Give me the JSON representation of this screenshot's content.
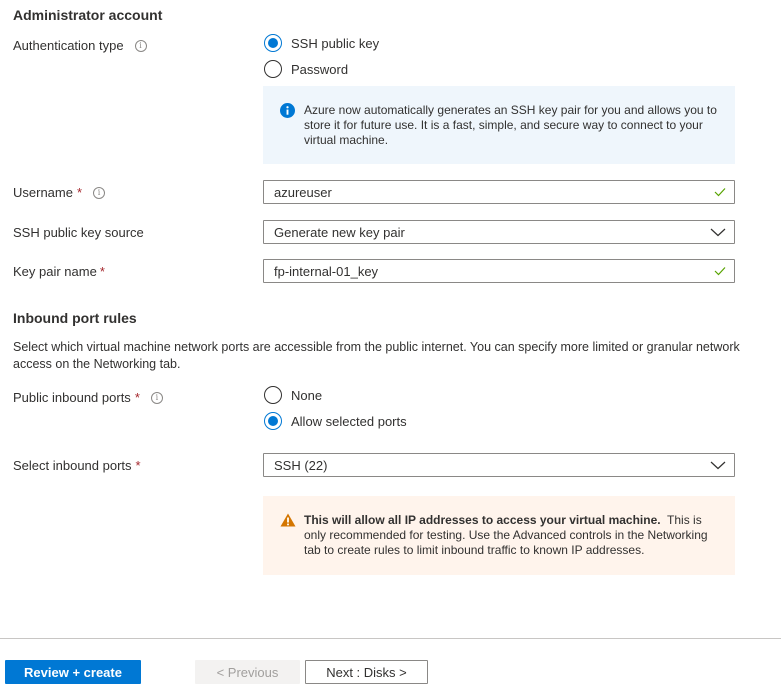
{
  "admin_section": {
    "title": "Administrator account",
    "auth_type": {
      "label": "Authentication type",
      "options": [
        {
          "label": "SSH public key",
          "selected": true
        },
        {
          "label": "Password",
          "selected": false
        }
      ]
    },
    "info_message": "Azure now automatically generates an SSH key pair for you and allows you to store it for future use. It is a fast, simple, and secure way to connect to your virtual machine.",
    "username": {
      "label": "Username",
      "required_mark": "*",
      "value": "azureuser",
      "valid": true
    },
    "ssh_key_source": {
      "label": "SSH public key source",
      "value": "Generate new key pair"
    },
    "key_pair_name": {
      "label": "Key pair name",
      "required_mark": "*",
      "value": "fp-internal-01_key",
      "valid": true
    }
  },
  "inbound_section": {
    "title": "Inbound port rules",
    "description": "Select which virtual machine network ports are accessible from the public internet. You can specify more limited or granular network access on the Networking tab.",
    "public_inbound_ports": {
      "label": "Public inbound ports",
      "required_mark": "*",
      "options": [
        {
          "label": "None",
          "selected": false
        },
        {
          "label": "Allow selected ports",
          "selected": true
        }
      ]
    },
    "select_inbound_ports": {
      "label": "Select inbound ports",
      "required_mark": "*",
      "value": "SSH (22)"
    },
    "warning": {
      "bold": "This will allow all IP addresses to access your virtual machine.",
      "text": "This is only recommended for testing.  Use the Advanced controls in the Networking tab to create rules to limit inbound traffic to known IP addresses."
    }
  },
  "footer": {
    "review_create": "Review + create",
    "previous": "< Previous",
    "next": "Next : Disks >"
  },
  "colors": {
    "accent": "#0078d4",
    "required": "#a4262c",
    "valid": "#57a300",
    "warning": "#d47500",
    "info_bg": "#eff6fc",
    "warning_bg": "#fff4ec"
  }
}
